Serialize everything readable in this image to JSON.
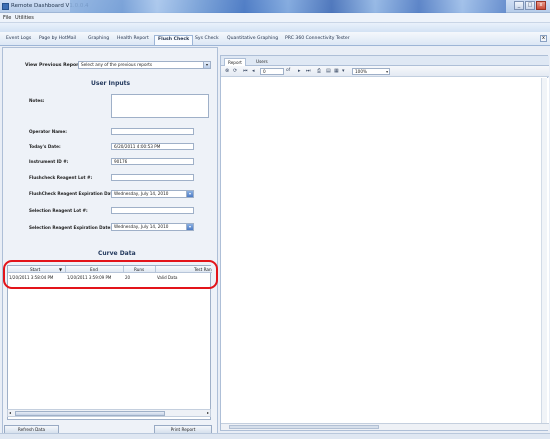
{
  "app": {
    "title": "Remote Dashboard   V1.0.0.4"
  },
  "window_buttons": {
    "minimize": "_",
    "maximize": "□",
    "close": "x"
  },
  "menu": {
    "file": "File",
    "utilities": "Utilities"
  },
  "tabs": [
    {
      "label": "Event Logs"
    },
    {
      "label": "Page by HotMail"
    },
    {
      "label": "Graphing"
    },
    {
      "label": "Health Report"
    },
    {
      "label": "Flush Check"
    },
    {
      "label": "Sys Check"
    },
    {
      "label": "Quantitative Graphing"
    },
    {
      "label": "PRC 360 Connectivity Tester"
    }
  ],
  "tabs_close": "x",
  "left": {
    "view_previous_label": "View Previous Reports:",
    "view_previous_value": "Select any of the previous reports",
    "user_inputs_title": "User Inputs",
    "notes_label": "Notes:",
    "operator_label": "Operator Name:",
    "operator_value": "",
    "todays_date_label": "Today's Date:",
    "todays_date_value": "6/20/2011 4:00:53 PM",
    "instrument_label": "Instrument ID #:",
    "instrument_value": "90176",
    "reagent_lot_label": "Flushcheck Reagent Lot #:",
    "reagent_lot_value": "",
    "reagent_exp_label": "FlushCheck Reagent Expiration Date:",
    "reagent_exp_value": "Wednesday, July 14, 2010",
    "selection_lot_label": "Selection Reagent Lot #:",
    "selection_lot_value": "",
    "selection_exp_label": "Selection Reagent Expiration Date:",
    "selection_exp_value": "Wednesday, July 14, 2010",
    "curve_data_title": "Curve Data",
    "grid": {
      "columns": [
        "Start",
        "End",
        "Runs",
        "Test Ran"
      ],
      "rows": [
        [
          "1/20/2011 3:58:04 PM",
          "1/20/2011 3:59:09 PM",
          "20",
          "Valid Data"
        ]
      ]
    },
    "buttons": {
      "left": "Refresh Data",
      "right": "Print Report"
    }
  },
  "viewer": {
    "tabs": [
      "Report",
      "Users"
    ],
    "page_value": "0",
    "page_of": "of",
    "zoom_value": "100%"
  },
  "colors": {
    "highlight": "#e3141a",
    "accent": "#4c7bc4"
  }
}
